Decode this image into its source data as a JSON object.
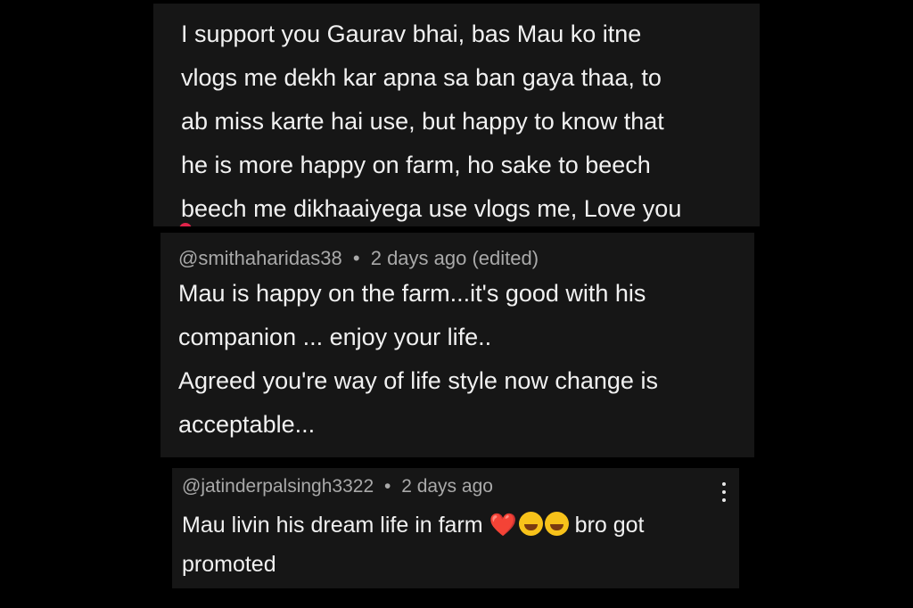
{
  "comments": [
    {
      "text": "I support you Gaurav bhai, bas Mau ko itne\nvlogs me dekh kar apna sa ban gaya thaa, to\nab miss karte hai use, but happy to know that\nhe is more happy on farm, ho sake to beech\nbeech me dikhaaiyega use vlogs me, Love you"
    },
    {
      "author": "@smithaharidas38",
      "separator": "•",
      "time": "2 days ago (edited)",
      "text": "Mau is happy on the farm...it's good with his\ncompanion ... enjoy your life..\nAgreed you're way of life style now change is\nacceptable..."
    },
    {
      "author": "@jatinderpalsingh3322",
      "separator": "•",
      "time": "2 days ago",
      "text_before": "Mau livin his dream life in farm",
      "heart": "❤️",
      "emoji_name": "laughing-tears-emoji",
      "text_after": "bro got",
      "text_line2": "promoted"
    }
  ]
}
